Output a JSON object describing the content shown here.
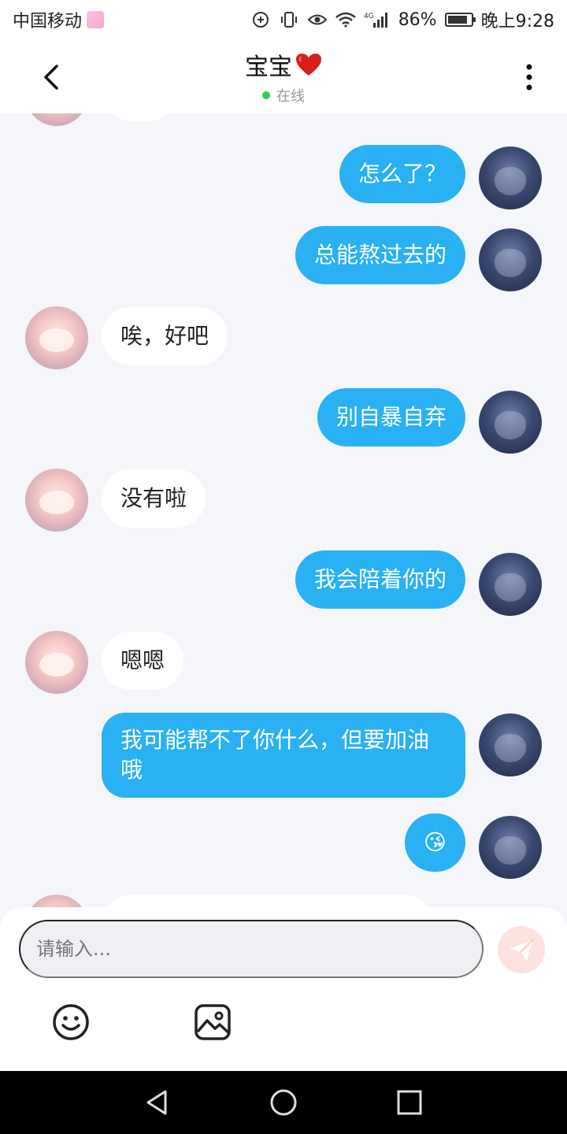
{
  "status_bar": {
    "carrier": "中国移动",
    "network": "4G",
    "battery": "86%",
    "battery_level": 0.86,
    "time": "晚上9:28"
  },
  "header": {
    "title": "宝宝",
    "title_emoji": "❤️",
    "status": "在线",
    "icons": {
      "back": "back-arrow-icon",
      "more": "more-vertical-icon"
    }
  },
  "messages": [
    {
      "from": "self",
      "text": "怎么了？"
    },
    {
      "from": "self",
      "text": "总能熬过去的"
    },
    {
      "from": "other",
      "text": "唉，好吧"
    },
    {
      "from": "self",
      "text": "别自暴自弃"
    },
    {
      "from": "other",
      "text": "没有啦"
    },
    {
      "from": "self",
      "text": "我会陪着你的"
    },
    {
      "from": "other",
      "text": "嗯嗯"
    },
    {
      "from": "self",
      "text": "我可能帮不了你什么，但要加油哦"
    },
    {
      "from": "self",
      "text": "😘"
    }
  ],
  "composer": {
    "placeholder": "请输入...",
    "icons": {
      "send": "send-icon",
      "emoji": "emoji-icon",
      "image": "image-icon"
    }
  },
  "colors": {
    "self_bubble": "#29b1f4",
    "other_bubble": "#ffffff",
    "background": "#f4f6f9",
    "online": "#2fcc55"
  }
}
